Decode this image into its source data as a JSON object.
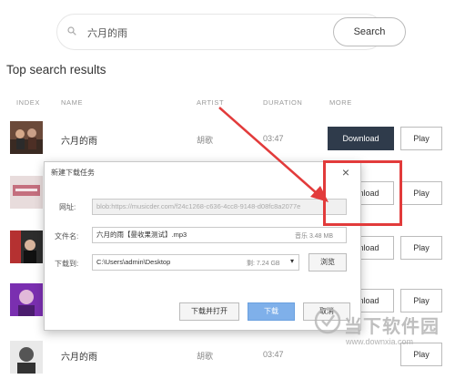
{
  "search": {
    "value": "六月的雨",
    "button_label": "Search"
  },
  "page_title": "Top search results",
  "table": {
    "headers": [
      "INDEX",
      "NAME",
      "ARTIST",
      "DURATION",
      "MORE"
    ]
  },
  "rows": [
    {
      "name": "六月的雨",
      "artist": "胡歌",
      "duration": "03:47",
      "download_label": "Download",
      "play_label": "Play"
    },
    {
      "name": "",
      "artist": "",
      "duration": "",
      "download_label": "Download",
      "play_label": "Play"
    },
    {
      "name": "",
      "artist": "",
      "duration": "",
      "download_label": "Download",
      "play_label": "Play"
    },
    {
      "name": "",
      "artist": "",
      "duration": "",
      "download_label": "Download",
      "play_label": "Play"
    },
    {
      "name": "六月的雨",
      "artist": "胡歌",
      "duration": "03:47",
      "download_label": "",
      "play_label": "Play"
    }
  ],
  "dialog": {
    "title": "新建下载任务",
    "url_label": "网址:",
    "url_value": "blob:https://musicder.com/f24c1268-c636-4cc8-9148-d08fc8a2077e",
    "filename_label": "文件名:",
    "filename_value": "六月的雨【曼收果测试】.mp3",
    "size_note": "音乐 3.48 MB",
    "saveto_label": "下载到:",
    "saveto_value": "C:\\Users\\admin\\Desktop",
    "free_space": "剩: 7.24 GB",
    "browse_label": "浏览",
    "open_after_label": "下载并打开",
    "download_label": "下载",
    "cancel_label": "取消"
  },
  "watermark": {
    "text": "当下软件园",
    "url": "www.downxia.com"
  },
  "colors": {
    "primary_button": "#2f3b4b",
    "annotation_red": "#e23b3b",
    "dialog_blue_button": "#7fb0ea"
  }
}
